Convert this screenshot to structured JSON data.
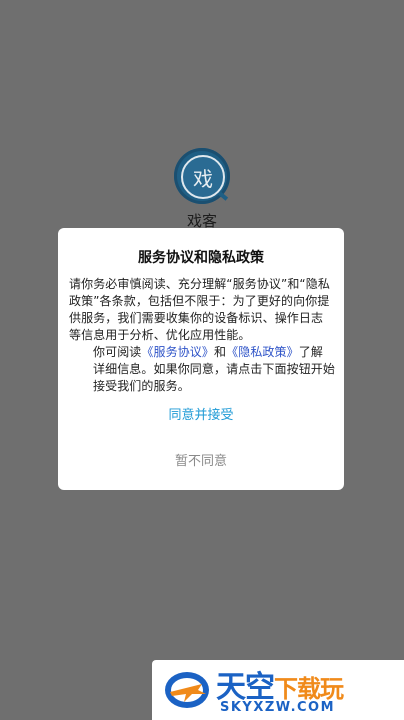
{
  "app": {
    "logo_char": "戏",
    "name": "戏客"
  },
  "dialog": {
    "title": "服务协议和隐私政策",
    "paragraph1": "请你务必审慎阅读、充分理解“服务协议”和“隐私政策”各条款，包括但不限于：为了更好的向你提供服务，我们需要收集你的设备标识、操作日志等信息用于分析、优化应用性能。",
    "p2_prefix": "你可阅读",
    "service_link": "《服务协议》",
    "p2_and": "和",
    "privacy_link": "《隐私政策》",
    "p2_suffix": "了解详细信息。如果你同意，请点击下面按钮开始接受我们的服务。",
    "agree_label": "同意并接受",
    "disagree_label": "暂不同意"
  },
  "watermark": {
    "title_main": "天空",
    "title_accent": "下载玩",
    "url": "SKYXZW.COM"
  },
  "colors": {
    "overlay": "#6f6f6f",
    "agree": "#1e9ad6",
    "link": "#2f54c8",
    "disagree": "#8a8a8a"
  }
}
